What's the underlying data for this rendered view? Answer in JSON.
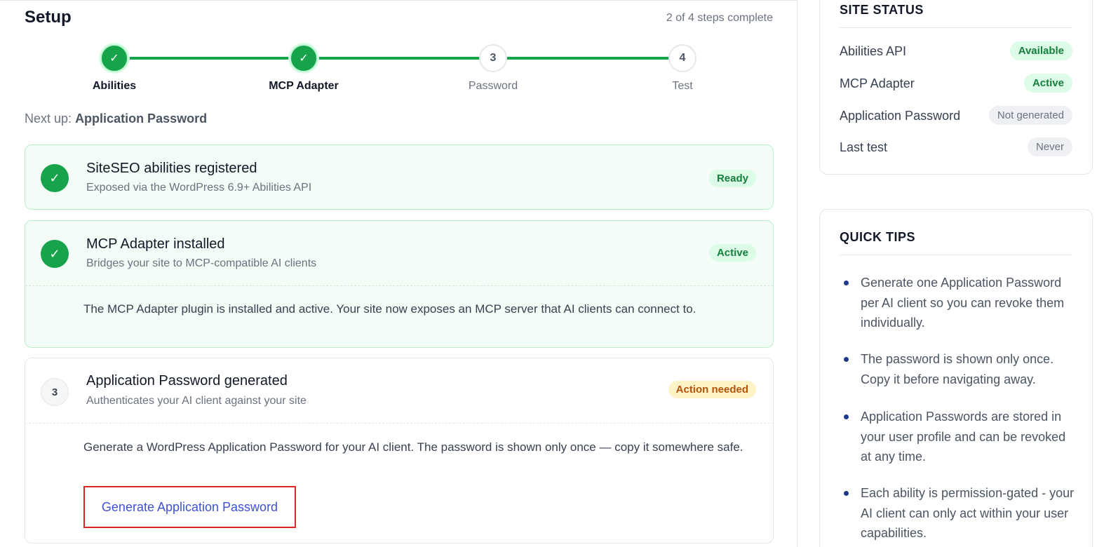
{
  "header": {
    "title": "Setup",
    "progress_text": "2 of 4 steps complete"
  },
  "stepper": {
    "steps": [
      {
        "label": "Abilities",
        "marker": "✓",
        "state": "done"
      },
      {
        "label": "MCP Adapter",
        "marker": "✓",
        "state": "done"
      },
      {
        "label": "Password",
        "marker": "3",
        "state": "todo"
      },
      {
        "label": "Test",
        "marker": "4",
        "state": "todo"
      }
    ]
  },
  "next_up": {
    "prefix": "Next up:",
    "value": "Application Password"
  },
  "cards": [
    {
      "marker": "✓",
      "title": "SiteSEO abilities registered",
      "subtitle": "Exposed via the WordPress 6.9+ Abilities API",
      "badge": "Ready"
    },
    {
      "marker": "✓",
      "title": "MCP Adapter installed",
      "subtitle": "Bridges your site to MCP-compatible AI clients",
      "badge": "Active",
      "body": "The MCP Adapter plugin is installed and active. Your site now exposes an MCP server that AI clients can connect to."
    },
    {
      "marker": "3",
      "title": "Application Password generated",
      "subtitle": "Authenticates your AI client against your site",
      "badge": "Action needed",
      "body": "Generate a WordPress Application Password for your AI client. The password is shown only once — copy it somewhere safe.",
      "button": "Generate Application Password"
    }
  ],
  "site_status": {
    "heading": "SITE STATUS",
    "rows": [
      {
        "label": "Abilities API",
        "value": "Available"
      },
      {
        "label": "MCP Adapter",
        "value": "Active"
      },
      {
        "label": "Application Password",
        "value": "Not generated"
      },
      {
        "label": "Last test",
        "value": "Never"
      }
    ]
  },
  "quick_tips": {
    "heading": "QUICK TIPS",
    "items": [
      "Generate one Application Password per AI client so you can revoke them individually.",
      "The password is shown only once. Copy it before navigating away.",
      "Application Passwords are stored in your user profile and can be revoked at any time.",
      "Each ability is permission-gated - your AI client can only act within your user capabilities."
    ]
  },
  "colors": {
    "success": "#16a34a",
    "warning": "#b45309",
    "link": "#3f51d6",
    "highlight": "#dc2626"
  }
}
